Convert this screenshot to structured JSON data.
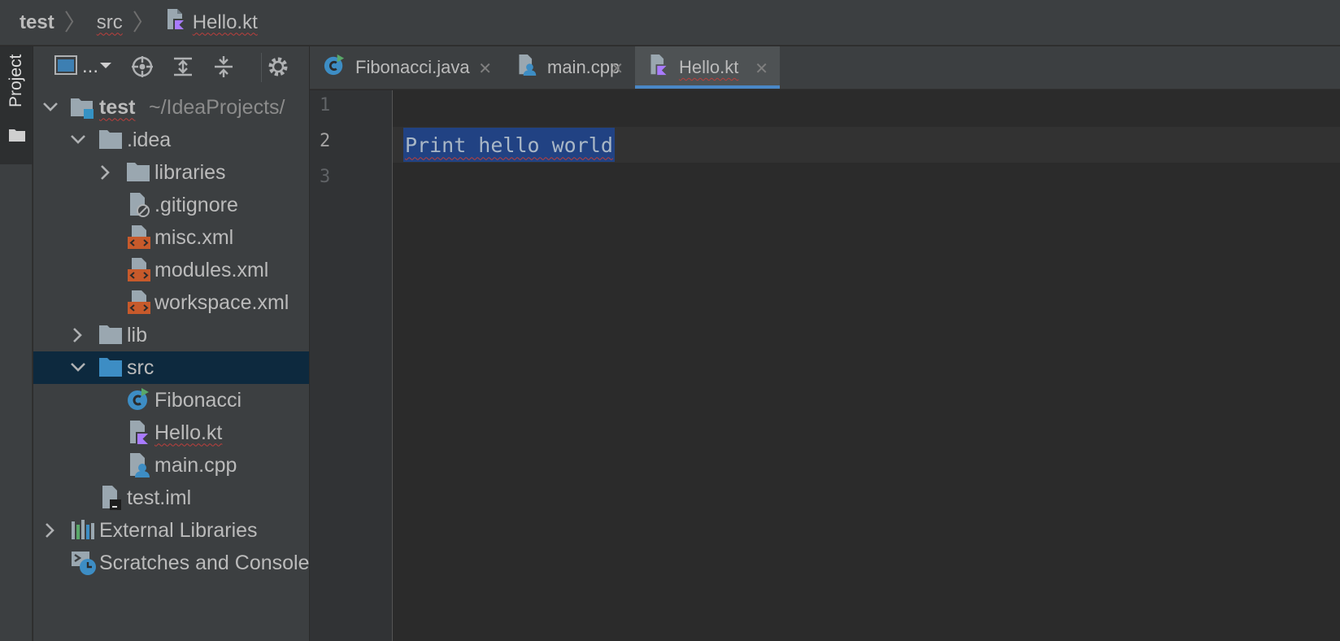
{
  "breadcrumb": {
    "project": "test",
    "folder": "src",
    "file": "Hello.kt",
    "file_icon": "kotlin-file-icon"
  },
  "tool_stripe": {
    "project_label": "Project",
    "icon": "folder-icon"
  },
  "panel_toolbar": {
    "view_selector": "...",
    "buttons": [
      "locate-icon",
      "expand-all-icon",
      "collapse-all-icon",
      "gear-icon"
    ]
  },
  "tree": [
    {
      "label": "test",
      "path": "~/IdeaProjects/",
      "icon": "module-folder-icon",
      "expanded": true
    },
    {
      "label": ".idea",
      "icon": "folder-icon",
      "expanded": true
    },
    {
      "label": "libraries",
      "icon": "folder-icon",
      "expanded": false
    },
    {
      "label": ".gitignore",
      "icon": "ignored-file-icon"
    },
    {
      "label": "misc.xml",
      "icon": "xml-file-icon"
    },
    {
      "label": "modules.xml",
      "icon": "xml-file-icon"
    },
    {
      "label": "workspace.xml",
      "icon": "xml-file-icon"
    },
    {
      "label": "lib",
      "icon": "folder-icon",
      "expanded": false
    },
    {
      "label": "src",
      "icon": "source-folder-icon",
      "expanded": true,
      "selected": true
    },
    {
      "label": "Fibonacci",
      "icon": "java-class-icon"
    },
    {
      "label": "Hello.kt",
      "icon": "kotlin-file-icon"
    },
    {
      "label": "main.cpp",
      "icon": "cpp-file-icon"
    },
    {
      "label": "test.iml",
      "icon": "iml-file-icon"
    },
    {
      "label": "External Libraries",
      "icon": "libraries-icon",
      "expanded": false
    },
    {
      "label": "Scratches and Consoles",
      "icon": "scratches-icon"
    }
  ],
  "tabs": [
    {
      "label": "Fibonacci.java",
      "icon": "java-class-icon",
      "active": false
    },
    {
      "label": "main.cpp",
      "icon": "cpp-file-icon",
      "active": false
    },
    {
      "label": "Hello.kt",
      "icon": "kotlin-file-icon",
      "active": true
    }
  ],
  "editor": {
    "line_numbers": [
      "1",
      "2",
      "3"
    ],
    "current_line": "2",
    "lines": [
      "",
      "Print hello world",
      ""
    ],
    "selection": "Print hello world"
  },
  "colors": {
    "panel_bg": "#3c3f41",
    "editor_bg": "#2b2b2b",
    "selection_bg": "#214283",
    "tree_selected_bg": "#0d293e",
    "active_tab_underline": "#4a88c7",
    "error_squiggle": "#bc3f3c"
  }
}
